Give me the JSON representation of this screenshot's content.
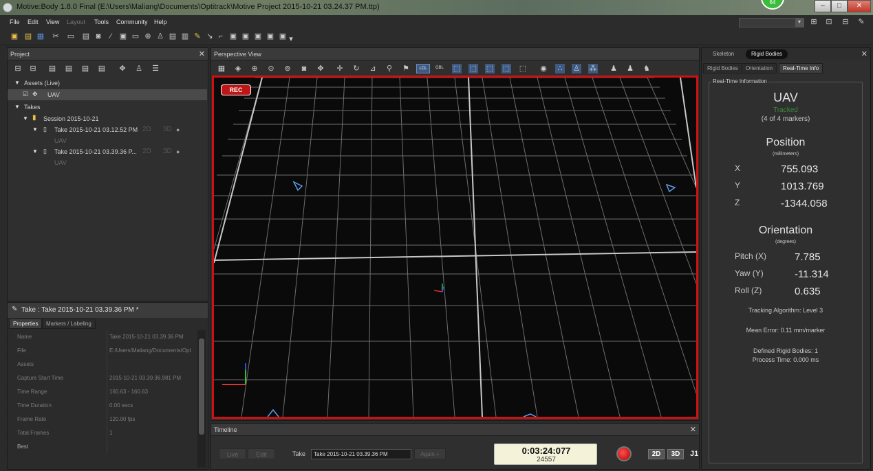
{
  "window": {
    "title": "Motive:Body 1.8.0 Final (E:\\Users\\Maliang\\Documents\\Optitrack\\Motive Project 2015-10-21 03.24.37 PM.ttp)",
    "badge": "64",
    "minimize": "–",
    "maximize": "□",
    "close": "✕"
  },
  "menu": {
    "items": [
      {
        "label": "File",
        "enabled": true
      },
      {
        "label": "Edit",
        "enabled": true
      },
      {
        "label": "View",
        "enabled": true
      },
      {
        "label": "Layout",
        "enabled": false
      },
      {
        "label": "Tools",
        "enabled": true
      },
      {
        "label": "Community",
        "enabled": true
      },
      {
        "label": "Help",
        "enabled": true
      }
    ]
  },
  "project": {
    "title": "Project",
    "close": "✕",
    "assets_label": "Assets (Live)",
    "asset_name": "UAV",
    "takes_label": "Takes",
    "session_label": "Session 2015-10-21",
    "takes": [
      {
        "name": "Take 2015-10-21 03.12.52 PM",
        "asset": "UAV",
        "d2": "2D",
        "d3": "3D"
      },
      {
        "name": "Take 2015-10-21 03.39.36 P...",
        "asset": "UAV",
        "d2": "2D",
        "d3": "3D"
      }
    ]
  },
  "properties": {
    "header": "Take : Take 2015-10-21 03.39.36 PM *",
    "tabs": [
      "Properties",
      "Markers / Labeling"
    ],
    "rows": [
      {
        "key": "Name",
        "value": "Take 2015-10-21 03.39.36 PM"
      },
      {
        "key": "File",
        "value": "E:/Users/Maliang/Documents/Opt"
      },
      {
        "key": "Assets",
        "value": ""
      },
      {
        "key": "Capture Start Time",
        "value": "2015-10-21 03.39.36.981 PM"
      },
      {
        "key": "Time Range",
        "value": "160.63 - 160.63"
      },
      {
        "key": "Time Duration",
        "value": "0.00 secs"
      },
      {
        "key": "Frame Rate",
        "value": "120.00 fps"
      },
      {
        "key": "Total Frames",
        "value": "1"
      },
      {
        "key": "Best",
        "value": ""
      }
    ]
  },
  "perspective": {
    "title": "Perspective View",
    "rec": "REC",
    "lcl": "LCL",
    "gbl": "GBL"
  },
  "right_panel": {
    "top_tabs": [
      "Skeleton",
      "Rigid Bodies"
    ],
    "sub_tabs": [
      "Rigid Bodies",
      "Orientation",
      "Real-Time Info"
    ],
    "close": "✕",
    "legend": "Real-Time Information",
    "body_name": "UAV",
    "status": "Tracked",
    "markers": "(4 of 4 markers)",
    "position_title": "Position",
    "position_unit": "(millimeters)",
    "position": [
      {
        "axis": "X",
        "value": "755.093"
      },
      {
        "axis": "Y",
        "value": "1013.769"
      },
      {
        "axis": "Z",
        "value": "-1344.058"
      }
    ],
    "orientation_title": "Orientation",
    "orientation_unit": "(degrees)",
    "orientation": [
      {
        "axis": "Pitch (X)",
        "value": "7.785"
      },
      {
        "axis": "Yaw (Y)",
        "value": "-11.314"
      },
      {
        "axis": "Roll (Z)",
        "value": "0.635"
      }
    ],
    "tracking_algorithm": "Tracking Algorithm: Level 3",
    "mean_error": "Mean Error: 0.11 mm/marker",
    "defined_bodies": "Defined Rigid Bodies: 1",
    "process_time": "Process Time: 0.000 ms"
  },
  "timeline": {
    "title": "Timeline",
    "close": "✕",
    "live": "Live",
    "edit": "Edit",
    "take_label": "Take",
    "take_value": "Take 2015-10-21 03.39.36 PM",
    "again": "Again +",
    "timecode": "0:03:24:077",
    "frame": "24557",
    "mode_2d": "2D",
    "mode_3d": "3D",
    "j": "J1"
  },
  "colors": {
    "rec_red": "#d01010",
    "tracked_green": "#3a8a3a",
    "timecode_bg": "#f4f2d9"
  }
}
